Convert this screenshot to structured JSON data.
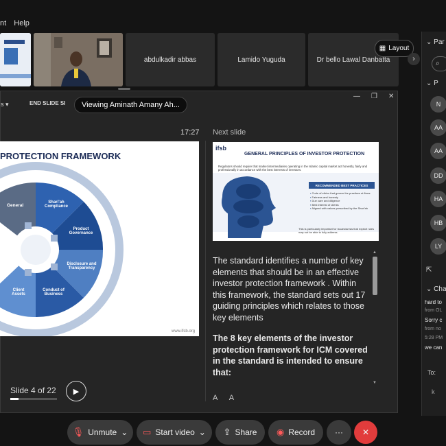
{
  "menu": {
    "items": [
      "nt",
      "Help"
    ]
  },
  "participants_strip": {
    "tiles": [
      {
        "name": ""
      },
      {
        "name": ""
      },
      {
        "name": "abdulkadir abbas"
      },
      {
        "name": "Lamido Yuguda"
      },
      {
        "name": "Dr bello Lawal Danbatta"
      }
    ],
    "layout_label": "Layout"
  },
  "presenter": {
    "toolbar": {
      "dropdown": "s ▾",
      "end_slide": "END SLIDE SI"
    },
    "viewing_tooltip": "Viewing Aminath Amany Ah...",
    "timer": "17:27",
    "next_label": "Next slide",
    "slide": {
      "title": "PROTECTION FRAMEWORK",
      "segments": [
        "General",
        "Shari'ah Compliance",
        "Product Governance",
        "Disclosure and Transparency",
        "Conduct of Business",
        "Client Assets"
      ],
      "url": "www.ifsb.org"
    },
    "next_slide": {
      "logo": "ifsb",
      "title": "GENERAL PRINCIPLES OF INVESTOR PROTECTION",
      "intro": "Regulators should require that market intermediaries operating in the Islamic capital market act honestly, fairly and professionally in accordance with the best interests of investors.",
      "recommended": "RECOMMENDED BEST PRACTICES",
      "list": [
        "Code of ethics that govern the practices at firms:",
        "Fairness and honesty",
        "Due care and diligence",
        "Best interest of clients",
        "Aligned with values prescribed by the Shari'ah"
      ],
      "footer": "This is particularly important for issues/areas that explicit rules may not be able to fully address."
    },
    "notes": {
      "p1": "The standard identifies a number of key elements that should be in an effective investor protection framework . Within this framework, the standard sets out 17 guiding principles which relates to those key elements",
      "p2": "The 8 key elements of the investor protection framework for ICM covered in the standard is intended to ensure that:"
    },
    "font_buttons": [
      "A",
      "A"
    ],
    "slide_counter": "Slide 4 of 22",
    "progress": 0.18
  },
  "right_panel": {
    "participants_header": "Par",
    "panelists_header": "P",
    "avatars": [
      "N",
      "AA",
      "AA",
      "DD",
      "HA",
      "HB",
      "LY"
    ],
    "chat_header": "Cha",
    "chat": [
      {
        "text": "hard to",
        "meta": false
      },
      {
        "text": "from OL",
        "meta": true
      },
      {
        "text": "Sorry c",
        "meta": false
      },
      {
        "text": "from no",
        "meta": true
      },
      {
        "text": "5:28 PM",
        "meta": true
      },
      {
        "text": "we can",
        "meta": false
      }
    ],
    "to_label": "To:",
    "input_char": "k"
  },
  "controls": {
    "unmute": "Unmute",
    "start_video": "Start video",
    "share": "Share",
    "record": "Record",
    "more": "···",
    "leave": "✕"
  },
  "colors": {
    "accent_red": "#e23c3c",
    "slide_navy": "#1a2a55",
    "wheel_blue": "#4f7fc2"
  }
}
